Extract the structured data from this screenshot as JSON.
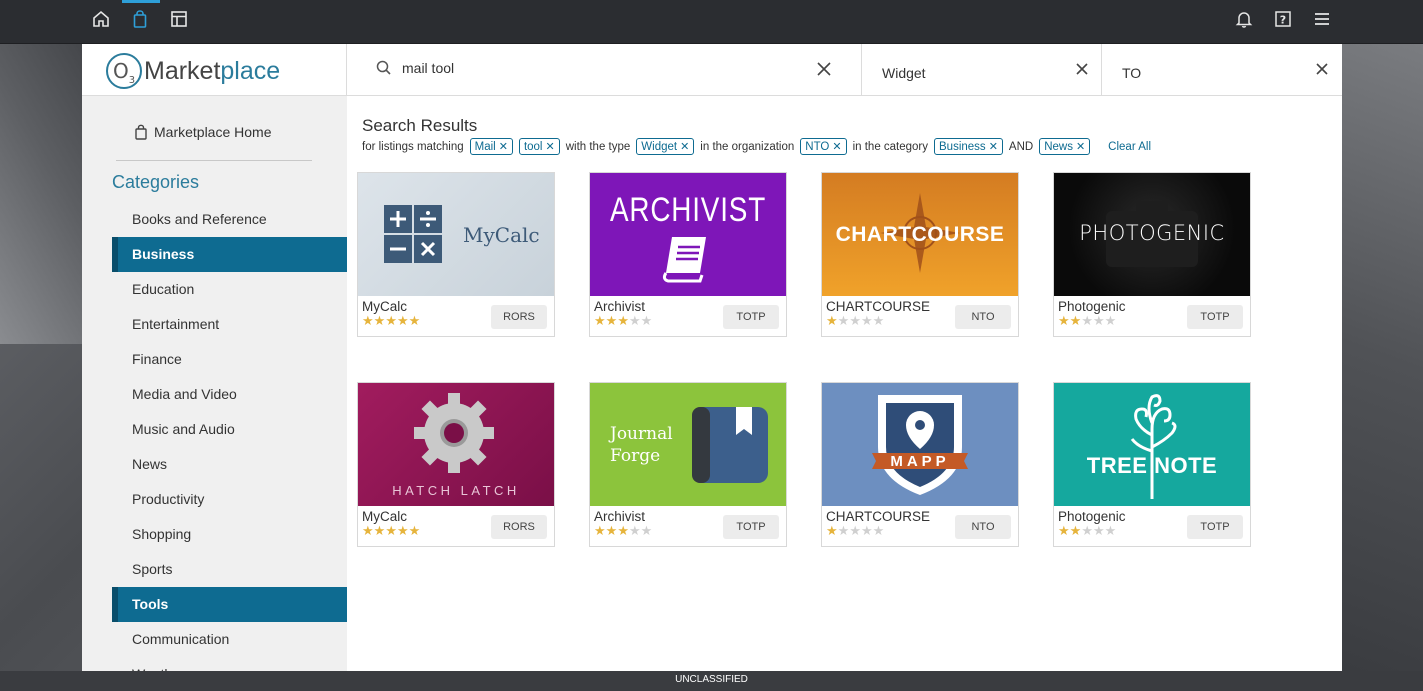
{
  "topbar": {
    "icons": [
      "home-icon",
      "shopping-bag-icon",
      "dashboard-icon",
      "bell-icon",
      "help-icon",
      "menu-icon"
    ]
  },
  "logo": {
    "o": "O",
    "sub": "3",
    "part1": "Market",
    "part2": "place"
  },
  "search": {
    "value": "mail tool"
  },
  "filters": {
    "type": "Widget",
    "org": "TO"
  },
  "sidebar": {
    "home_label": "Marketplace Home",
    "categories_title": "Categories",
    "categories": [
      {
        "label": "Books and Reference",
        "selected": false
      },
      {
        "label": "Business",
        "selected": true
      },
      {
        "label": "Education",
        "selected": false
      },
      {
        "label": "Entertainment",
        "selected": false
      },
      {
        "label": "Finance",
        "selected": false
      },
      {
        "label": "Media and Video",
        "selected": false
      },
      {
        "label": "Music and Audio",
        "selected": false
      },
      {
        "label": "News",
        "selected": false
      },
      {
        "label": "Productivity",
        "selected": false
      },
      {
        "label": "Shopping",
        "selected": false
      },
      {
        "label": "Sports",
        "selected": false
      },
      {
        "label": "Tools",
        "selected": true
      },
      {
        "label": "Communication",
        "selected": false
      },
      {
        "label": "Weather",
        "selected": false
      }
    ]
  },
  "results": {
    "title": "Search Results",
    "t_for": "for listings matching",
    "chip_mail": "Mail",
    "chip_tool": "tool",
    "t_type": "with the type",
    "chip_widget": "Widget",
    "t_org": "in the organization",
    "chip_nto": "NTO",
    "t_cat": "in the category",
    "chip_business": "Business",
    "t_and": "AND",
    "chip_news": "News",
    "clear_all": "Clear All"
  },
  "listings": [
    {
      "name": "MyCalc",
      "org": "RORS",
      "rating": 5,
      "art_text": "MyCalc"
    },
    {
      "name": "Archivist",
      "org": "TOTP",
      "rating": 3,
      "art_text": "ARCHIVIST"
    },
    {
      "name": "CHARTCOURSE",
      "org": "NTO",
      "rating": 1,
      "art_text": "CHARTCOURSE"
    },
    {
      "name": "Photogenic",
      "org": "TOTP",
      "rating": 2,
      "art_text": "PHOTOGENIC"
    },
    {
      "name": "MyCalc",
      "org": "RORS",
      "rating": 5,
      "art_text": "HATCH LATCH"
    },
    {
      "name": "Archivist",
      "org": "TOTP",
      "rating": 3,
      "art_text": "Journal Forge"
    },
    {
      "name": "CHARTCOURSE",
      "org": "NTO",
      "rating": 1,
      "art_text": "MAPP"
    },
    {
      "name": "Photogenic",
      "org": "TOTP",
      "rating": 2,
      "art_text": "TREE NOTE"
    }
  ],
  "classification": "UNCLASSIFIED"
}
